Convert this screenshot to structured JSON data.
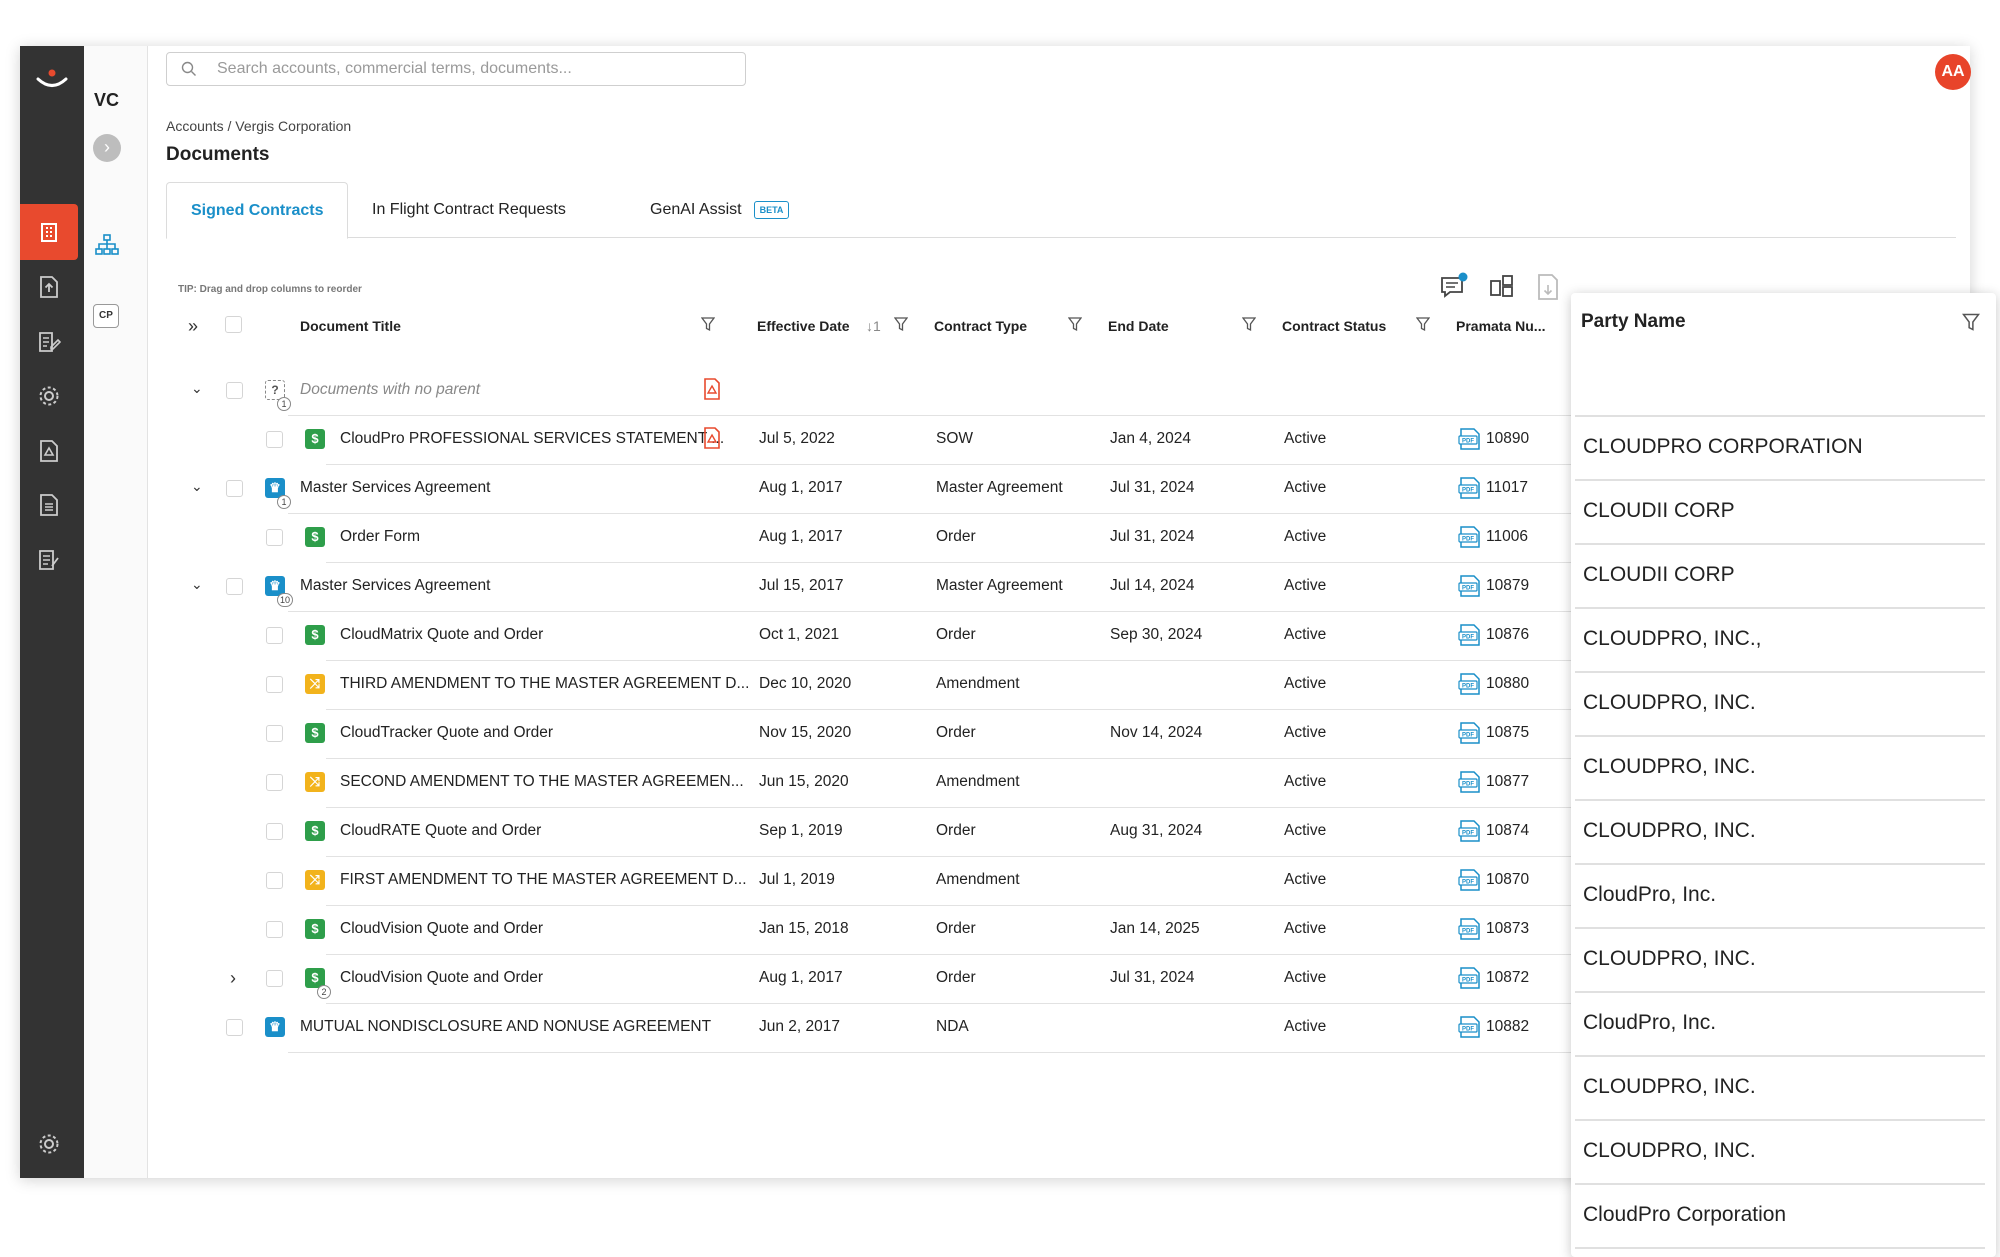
{
  "search": {
    "placeholder": "Search accounts, commercial terms, documents..."
  },
  "user": {
    "initials": "AA"
  },
  "subnav": {
    "account_code": "VC",
    "cp_label": "CP"
  },
  "breadcrumb": "Accounts / Vergis Corporation",
  "page_title": "Documents",
  "tabs": [
    {
      "label": "Signed Contracts",
      "active": true
    },
    {
      "label": "In Flight Contract Requests",
      "active": false
    },
    {
      "label": "GenAI Assist",
      "active": false,
      "badge": "BETA"
    }
  ],
  "tip": "TIP: Drag and drop columns to reorder",
  "columns": {
    "title": "Document Title",
    "effective": "Effective Date",
    "sort_indicator": "1",
    "type": "Contract Type",
    "end": "End Date",
    "status": "Contract Status",
    "number": "Pramata Nu..."
  },
  "rows": [
    {
      "title": "Documents with no parent",
      "icon": "?",
      "badge": "1",
      "effective": "",
      "type": "",
      "end": "",
      "status": "",
      "number": ""
    },
    {
      "title": "CloudPro PROFESSIONAL SERVICES STATEMENT ...",
      "icon": "$",
      "badge": "",
      "effective": "Jul 5, 2022",
      "type": "SOW",
      "end": "Jan 4, 2024",
      "status": "Active",
      "number": "10890"
    },
    {
      "title": "Master Services Agreement",
      "icon": "♛",
      "badge": "1",
      "effective": "Aug 1, 2017",
      "type": "Master Agreement",
      "end": "Jul 31, 2024",
      "status": "Active",
      "number": "11017"
    },
    {
      "title": "Order Form",
      "icon": "$",
      "badge": "",
      "effective": "Aug 1, 2017",
      "type": "Order",
      "end": "Jul 31, 2024",
      "status": "Active",
      "number": "11006"
    },
    {
      "title": "Master Services Agreement",
      "icon": "♛",
      "badge": "10",
      "effective": "Jul 15, 2017",
      "type": "Master Agreement",
      "end": "Jul 14, 2024",
      "status": "Active",
      "number": "10879"
    },
    {
      "title": "CloudMatrix Quote and Order",
      "icon": "$",
      "badge": "",
      "effective": "Oct 1, 2021",
      "type": "Order",
      "end": "Sep 30, 2024",
      "status": "Active",
      "number": "10876"
    },
    {
      "title": "THIRD AMENDMENT TO THE MASTER AGREEMENT D...",
      "icon": "⤨",
      "badge": "",
      "effective": "Dec 10, 2020",
      "type": "Amendment",
      "end": "",
      "status": "Active",
      "number": "10880"
    },
    {
      "title": "CloudTracker Quote and Order",
      "icon": "$",
      "badge": "",
      "effective": "Nov 15, 2020",
      "type": "Order",
      "end": "Nov 14, 2024",
      "status": "Active",
      "number": "10875"
    },
    {
      "title": "SECOND AMENDMENT TO THE MASTER AGREEMEN...",
      "icon": "⤨",
      "badge": "",
      "effective": "Jun 15, 2020",
      "type": "Amendment",
      "end": "",
      "status": "Active",
      "number": "10877"
    },
    {
      "title": "CloudRATE Quote and Order",
      "icon": "$",
      "badge": "",
      "effective": "Sep 1, 2019",
      "type": "Order",
      "end": "Aug 31, 2024",
      "status": "Active",
      "number": "10874"
    },
    {
      "title": "FIRST AMENDMENT TO THE MASTER AGREEMENT D...",
      "icon": "⤨",
      "badge": "",
      "effective": "Jul 1, 2019",
      "type": "Amendment",
      "end": "",
      "status": "Active",
      "number": "10870"
    },
    {
      "title": "CloudVision Quote and Order",
      "icon": "$",
      "badge": "",
      "effective": "Jan 15, 2018",
      "type": "Order",
      "end": "Jan 14, 2025",
      "status": "Active",
      "number": "10873"
    },
    {
      "title": "CloudVision Quote and Order",
      "icon": "$",
      "badge": "2",
      "effective": "Aug 1, 2017",
      "type": "Order",
      "end": "Jul 31, 2024",
      "status": "Active",
      "number": "10872"
    },
    {
      "title": "MUTUAL NONDISCLOSURE AND NONUSE AGREEMENT",
      "icon": "♛",
      "badge": "",
      "effective": "Jun 2, 2017",
      "type": "NDA",
      "end": "",
      "status": "Active",
      "number": "10882"
    }
  ],
  "party_panel": {
    "header": "Party Name",
    "items": [
      "CLOUDPRO CORPORATION",
      "CLOUDII CORP",
      "CLOUDII CORP",
      "CLOUDPRO, INC.,",
      "CLOUDPRO, INC.",
      "CLOUDPRO, INC.",
      "CLOUDPRO, INC.",
      "CloudPro, Inc.",
      "CLOUDPRO, INC.",
      "CloudPro, Inc.",
      "CLOUDPRO, INC.",
      "CLOUDPRO, INC.",
      "CloudPro Corporation"
    ]
  },
  "colors": {
    "accent": "#e84a2e",
    "link": "#1a8fc9",
    "order_icon": "#2e9e4a",
    "msa_icon": "#1a8fc9",
    "amendment_icon": "#f2b31c"
  }
}
